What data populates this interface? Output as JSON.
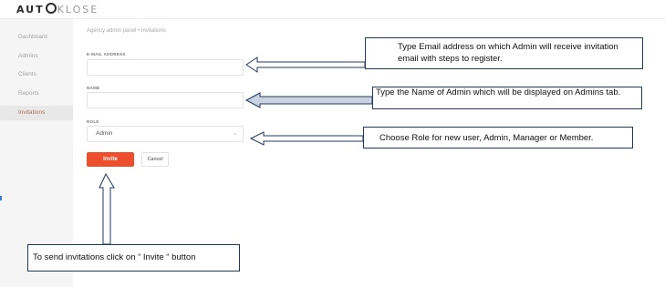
{
  "brand": {
    "logo_bold": "AUT",
    "logo_light": "KLOSE"
  },
  "sidebar": {
    "items": [
      {
        "label": "Dashboard",
        "active": false
      },
      {
        "label": "Admins",
        "active": false
      },
      {
        "label": "Clients",
        "active": false
      },
      {
        "label": "Reports",
        "active": false
      },
      {
        "label": "Invitations",
        "active": true
      }
    ]
  },
  "page": {
    "breadcrumb": "Agency admin panel • Invitations"
  },
  "form": {
    "email_label": "E-MAIL ADDRESS",
    "email_value": "",
    "name_label": "NAME",
    "name_value": "",
    "role_label": "ROLE",
    "role_value": "Admin",
    "invite_label": "Invite",
    "cancel_label": "Cancel"
  },
  "callouts": {
    "email": "Type Email address on which Admin will receive invitation email with steps to register.",
    "name": "Type the Name of Admin which will be displayed on Admins tab.",
    "role": "Choose Role for new user, Admin, Manager or Member.",
    "invite": "To send invitations click on “ Invite “ button"
  },
  "colors": {
    "accent": "#ee4e2c",
    "callout_border": "#1f3864",
    "arrow_fill": "#c9d3e0"
  }
}
